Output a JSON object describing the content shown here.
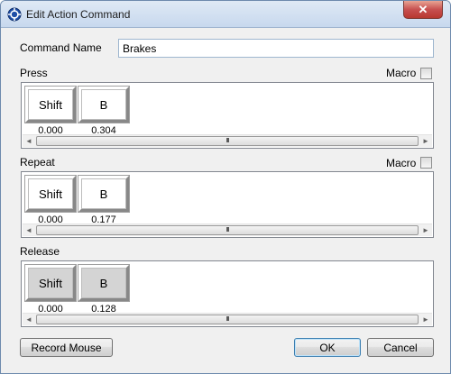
{
  "window": {
    "title": "Edit Action Command",
    "close_label": "✕"
  },
  "command": {
    "label": "Command Name",
    "value": "Brakes"
  },
  "sections": [
    {
      "label": "Press",
      "macro_label": "Macro",
      "macro_checked": false,
      "keys": [
        {
          "label": "Shift",
          "time": "0.000"
        },
        {
          "label": "B",
          "time": "0.304"
        }
      ]
    },
    {
      "label": "Repeat",
      "macro_label": "Macro",
      "macro_checked": false,
      "keys": [
        {
          "label": "Shift",
          "time": "0.000"
        },
        {
          "label": "B",
          "time": "0.177"
        }
      ]
    },
    {
      "label": "Release",
      "keys": [
        {
          "label": "Shift",
          "time": "0.000"
        },
        {
          "label": "B",
          "time": "0.128"
        }
      ]
    }
  ],
  "scrollbar": {
    "left_arrow": "◄",
    "right_arrow": "►",
    "grip": "III"
  },
  "buttons": {
    "record_mouse": "Record Mouse",
    "ok": "OK",
    "cancel": "Cancel"
  }
}
